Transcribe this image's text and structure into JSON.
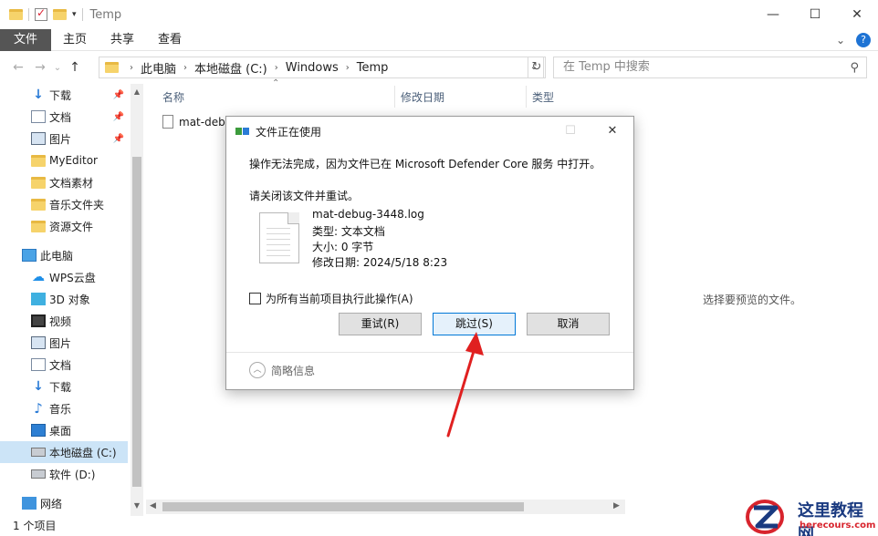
{
  "window": {
    "title": "Temp",
    "controls": {
      "minimize": "—",
      "maximize": "☐",
      "close": "✕"
    }
  },
  "ribbon": {
    "tabs": [
      "文件",
      "主页",
      "共享",
      "查看"
    ],
    "help": "?",
    "expand": "⌄"
  },
  "address": {
    "crumbs": [
      "此电脑",
      "本地磁盘 (C:)",
      "Windows",
      "Temp"
    ],
    "refresh": "↻",
    "search_placeholder": "在 Temp 中搜索",
    "search_icon": "⚲"
  },
  "nav_buttons": {
    "back": "←",
    "forward": "→",
    "recent": "⌄",
    "up": "↑"
  },
  "navpane": {
    "items": [
      {
        "label": "下载",
        "icon": "download-icon",
        "pinned": true
      },
      {
        "label": "文档",
        "icon": "document-icon",
        "pinned": true
      },
      {
        "label": "图片",
        "icon": "picture-icon",
        "pinned": true
      },
      {
        "label": "MyEditor",
        "icon": "folder-icon",
        "pinned": false
      },
      {
        "label": "文档素材",
        "icon": "folder-icon",
        "pinned": false
      },
      {
        "label": "音乐文件夹",
        "icon": "folder-icon",
        "pinned": false
      },
      {
        "label": "资源文件",
        "icon": "folder-icon",
        "pinned": false
      },
      {
        "label": "此电脑",
        "icon": "pc-icon",
        "pinned": false
      },
      {
        "label": "WPS云盘",
        "icon": "cloud-icon",
        "pinned": false
      },
      {
        "label": "3D 对象",
        "icon": "3d-objects-icon",
        "pinned": false
      },
      {
        "label": "视频",
        "icon": "video-icon",
        "pinned": false
      },
      {
        "label": "图片",
        "icon": "picture-icon",
        "pinned": false
      },
      {
        "label": "文档",
        "icon": "document-icon",
        "pinned": false
      },
      {
        "label": "下载",
        "icon": "download-icon",
        "pinned": false
      },
      {
        "label": "音乐",
        "icon": "music-icon",
        "pinned": false
      },
      {
        "label": "桌面",
        "icon": "desktop-icon",
        "pinned": false
      },
      {
        "label": "本地磁盘 (C:)",
        "icon": "disk-icon",
        "pinned": false,
        "selected": true
      },
      {
        "label": "软件 (D:)",
        "icon": "disk-icon",
        "pinned": false
      },
      {
        "label": "网络",
        "icon": "network-icon",
        "pinned": false
      }
    ]
  },
  "filelist": {
    "columns": [
      "名称",
      "修改日期",
      "类型"
    ],
    "files": [
      {
        "name": "mat-debug-3448.log"
      }
    ],
    "preview_text": "选择要预览的文件。"
  },
  "status": {
    "count": "1 个项目"
  },
  "dialog": {
    "title": "文件正在使用",
    "message": "操作无法完成，因为文件已在 Microsoft Defender Core 服务 中打开。",
    "instruction": "请关闭该文件并重试。",
    "file": {
      "name": "mat-debug-3448.log",
      "type": "类型: 文本文档",
      "size": "大小: 0 字节",
      "modified": "修改日期: 2024/5/18 8:23"
    },
    "apply_all": "为所有当前项目执行此操作(A)",
    "buttons": {
      "retry": "重试(R)",
      "skip": "跳过(S)",
      "cancel": "取消"
    },
    "less_info": "简略信息"
  },
  "watermark": {
    "name": "这里教程网",
    "url": "herecours.com"
  },
  "colors": {
    "accent": "#0078d7",
    "selection": "#cce4f7",
    "arrow": "#e02020"
  }
}
